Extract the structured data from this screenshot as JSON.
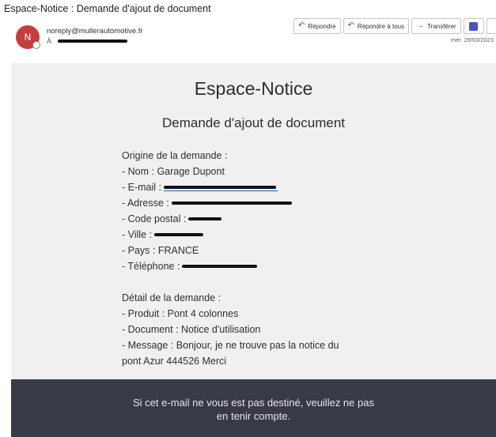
{
  "email": {
    "subject": "Espace-Notice : Demande d'ajout de document",
    "avatar_initial": "N",
    "sender": "noreply@mullerautomotive.fr",
    "to_label": "À",
    "date": "mer. 29/03/2023"
  },
  "actions": {
    "reply": "Répondre",
    "reply_all": "Répondre à tous",
    "forward": "Transférer",
    "teams_icon": "teams-icon"
  },
  "body": {
    "brand": "Espace-Notice",
    "heading": "Demande d'ajout de document",
    "origin_title": "Origine de la demande :",
    "nom": "- Nom : Garage Dupont",
    "email_label": "- E-mail :",
    "adresse_label": "- Adresse :",
    "code_postal_label": "- Code postal :",
    "ville_label": "- Ville :",
    "pays": "- Pays : FRANCE",
    "telephone_label": "- Téléphone :",
    "detail_title": "Détail de la demande :",
    "produit": "- Produit : Pont 4 colonnes",
    "document": "- Document : Notice d'utilisation",
    "message_line1": "- Message : Bonjour, je ne trouve pas la notice du",
    "message_line2": "pont Azur 444526 Merci"
  },
  "footer": {
    "line1": "Si cet e-mail ne vous est pas destiné, veuillez ne pas",
    "line2": "en tenir compte."
  },
  "colors": {
    "avatar": "#c43e3e",
    "accent": "#0f6cbd",
    "footer_bg": "#383a48",
    "panel_bg": "#f0f0f0"
  }
}
